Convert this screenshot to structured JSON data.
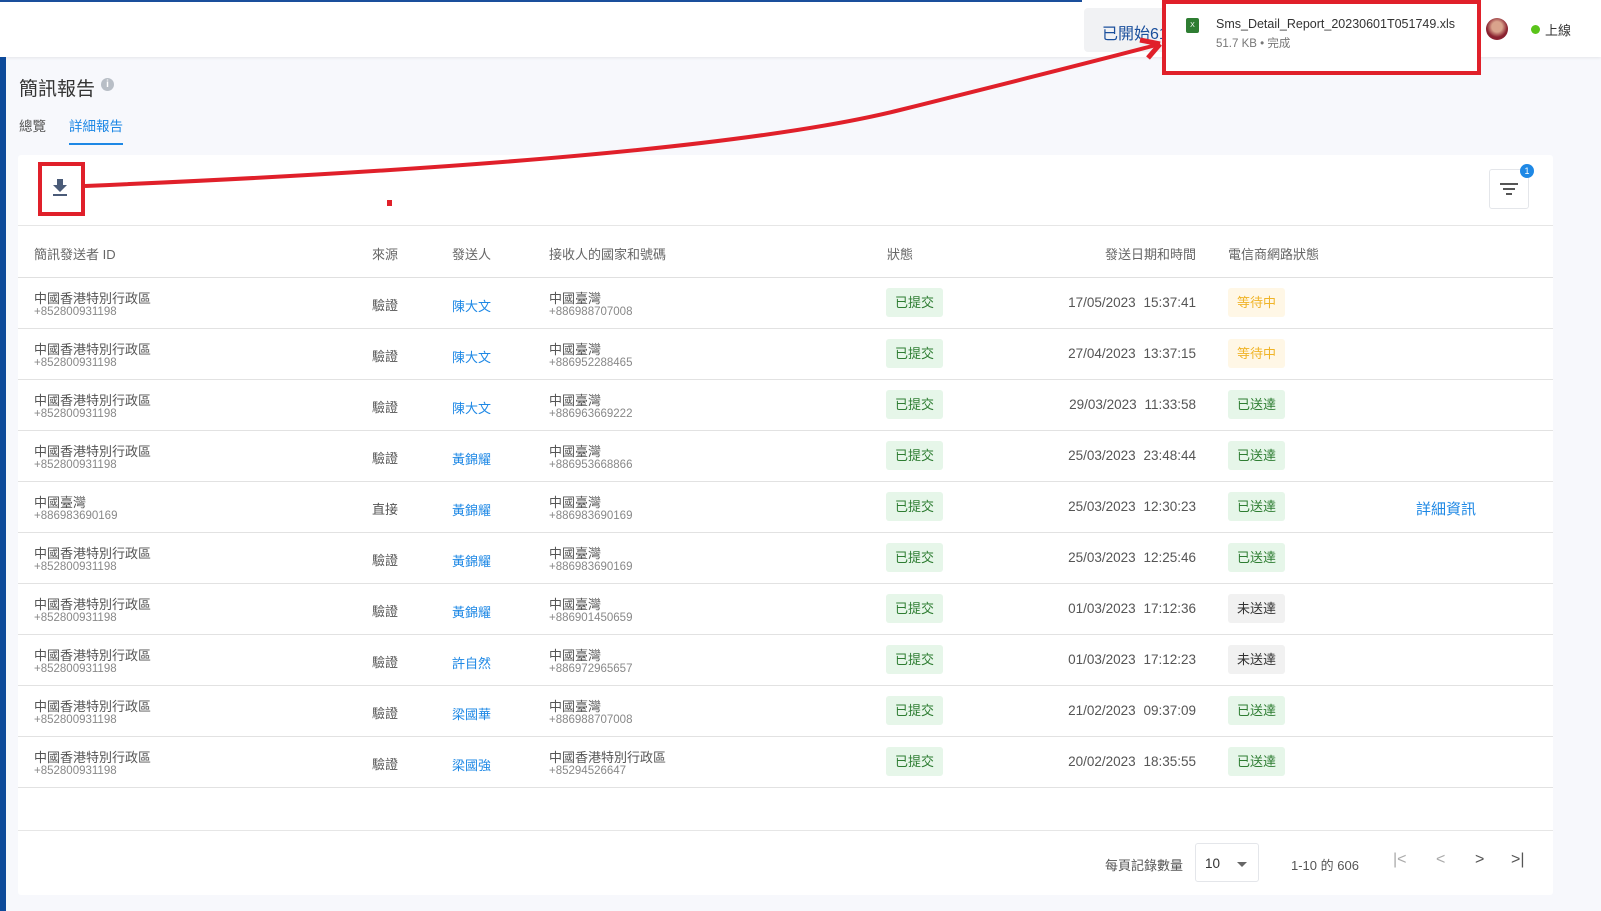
{
  "topbar": {
    "started_label": "已開始61",
    "online_label": "上線"
  },
  "download": {
    "filename": "Sms_Detail_Report_20230601T051749.xls",
    "meta": "51.7 KB • 完成",
    "file_icon": "excel-file-icon"
  },
  "page": {
    "title": "簡訊報告",
    "tabs": [
      {
        "label": "總覽"
      },
      {
        "label": "詳細報告",
        "active": true
      }
    ]
  },
  "toolbar": {
    "filter_badge": "1"
  },
  "table": {
    "headers": {
      "sender_id": "簡訊發送者 ID",
      "source": "來源",
      "sender": "發送人",
      "recipient": "接收人的國家和號碼",
      "status": "狀態",
      "datetime": "發送日期和時間",
      "carrier": "電信商網路狀態"
    },
    "rows": [
      {
        "id_region": "中國香港特別行政區",
        "id_number": "+852800931198",
        "source": "驗證",
        "sender": "陳大文",
        "rcpt_region": "中國臺灣",
        "rcpt_number": "+886988707008",
        "status": "已提交",
        "datetime": "17/05/2023 15:37:41",
        "carrier": "等待中",
        "carrier_type": "wait"
      },
      {
        "id_region": "中國香港特別行政區",
        "id_number": "+852800931198",
        "source": "驗證",
        "sender": "陳大文",
        "rcpt_region": "中國臺灣",
        "rcpt_number": "+886952288465",
        "status": "已提交",
        "datetime": "27/04/2023 13:37:15",
        "carrier": "等待中",
        "carrier_type": "wait"
      },
      {
        "id_region": "中國香港特別行政區",
        "id_number": "+852800931198",
        "source": "驗證",
        "sender": "陳大文",
        "rcpt_region": "中國臺灣",
        "rcpt_number": "+886963669222",
        "status": "已提交",
        "datetime": "29/03/2023 11:33:58",
        "carrier": "已送達",
        "carrier_type": "ok"
      },
      {
        "id_region": "中國香港特別行政區",
        "id_number": "+852800931198",
        "source": "驗證",
        "sender": "黃錦耀",
        "rcpt_region": "中國臺灣",
        "rcpt_number": "+886953668866",
        "status": "已提交",
        "datetime": "25/03/2023 23:48:44",
        "carrier": "已送達",
        "carrier_type": "ok"
      },
      {
        "id_region": "中國臺灣",
        "id_number": "+886983690169",
        "source": "直接",
        "sender": "黃錦耀",
        "rcpt_region": "中國臺灣",
        "rcpt_number": "+886983690169",
        "status": "已提交",
        "datetime": "25/03/2023 12:30:23",
        "carrier": "已送達",
        "carrier_type": "ok",
        "details": "詳細資訊"
      },
      {
        "id_region": "中國香港特別行政區",
        "id_number": "+852800931198",
        "source": "驗證",
        "sender": "黃錦耀",
        "rcpt_region": "中國臺灣",
        "rcpt_number": "+886983690169",
        "status": "已提交",
        "datetime": "25/03/2023 12:25:46",
        "carrier": "已送達",
        "carrier_type": "ok"
      },
      {
        "id_region": "中國香港特別行政區",
        "id_number": "+852800931198",
        "source": "驗證",
        "sender": "黃錦耀",
        "rcpt_region": "中國臺灣",
        "rcpt_number": "+886901450659",
        "status": "已提交",
        "datetime": "01/03/2023 17:12:36",
        "carrier": "未送達",
        "carrier_type": "none"
      },
      {
        "id_region": "中國香港特別行政區",
        "id_number": "+852800931198",
        "source": "驗證",
        "sender": "許自然",
        "rcpt_region": "中國臺灣",
        "rcpt_number": "+886972965657",
        "status": "已提交",
        "datetime": "01/03/2023 17:12:23",
        "carrier": "未送達",
        "carrier_type": "none"
      },
      {
        "id_region": "中國香港特別行政區",
        "id_number": "+852800931198",
        "source": "驗證",
        "sender": "梁國華",
        "rcpt_region": "中國臺灣",
        "rcpt_number": "+886988707008",
        "status": "已提交",
        "datetime": "21/02/2023 09:37:09",
        "carrier": "已送達",
        "carrier_type": "ok"
      },
      {
        "id_region": "中國香港特別行政區",
        "id_number": "+852800931198",
        "source": "驗證",
        "sender": "梁國強",
        "rcpt_region": "中國香港特別行政區",
        "rcpt_number": "+85294526647",
        "status": "已提交",
        "datetime": "20/02/2023 18:35:55",
        "carrier": "已送達",
        "carrier_type": "ok"
      }
    ]
  },
  "pagination": {
    "per_page_label": "每頁記錄數量",
    "per_page": "10",
    "range": "1-10 的 606"
  },
  "colors": {
    "accent": "#1e88e5",
    "annotation": "#e0202a"
  }
}
